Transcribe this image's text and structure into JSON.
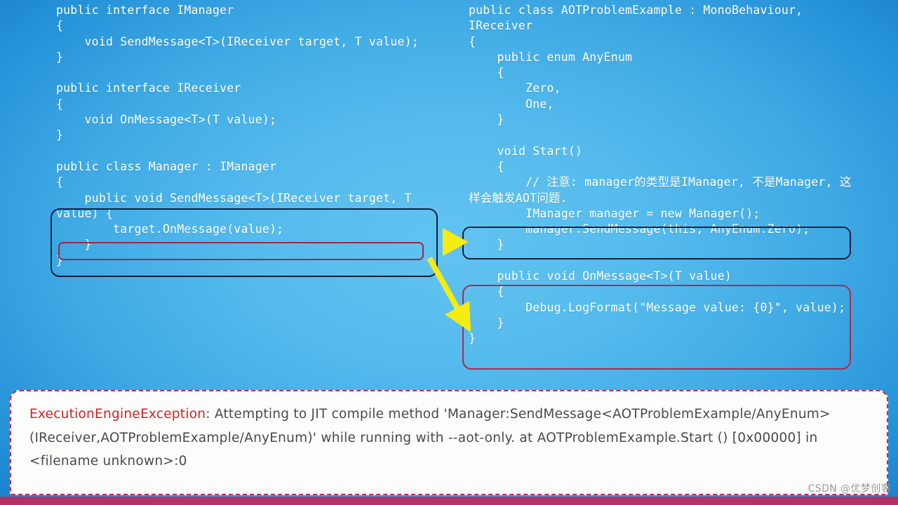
{
  "slide": {
    "background_color_center": "#5bbdee",
    "background_color_edge": "#0f6fc0"
  },
  "code_left": {
    "lines": [
      "public interface IManager",
      "{",
      "    void SendMessage<T>(IReceiver target, T value);",
      "}",
      "",
      "public interface IReceiver",
      "{",
      "    void OnMessage<T>(T value);",
      "}",
      "",
      "public class Manager : IManager",
      "{",
      "    public void SendMessage<T>(IReceiver target, T value) {",
      "        target.OnMessage(value);",
      "    }",
      "}"
    ]
  },
  "code_right": {
    "lines": [
      "public class AOTProblemExample : MonoBehaviour, IReceiver",
      "{",
      "    public enum AnyEnum",
      "    {",
      "        Zero,",
      "        One,",
      "    }",
      "",
      "    void Start()",
      "    {",
      "        // 注意: manager的类型是IManager, 不是Manager, 这样会触发AOT问题.",
      "        IManager manager = new Manager();",
      "        manager.SendMessage(this, AnyEnum.Zero);",
      "    }",
      "",
      "    public void OnMessage<T>(T value)",
      "    {",
      "        Debug.LogFormat(\"Message value: {0}\", value);",
      "    }",
      "}"
    ]
  },
  "annotations": {
    "box_sendmessage_impl_color": "#14203c",
    "box_target_onmessage_color": "#9e2a46",
    "box_manager_send_color": "#14203c",
    "box_onmessage_impl_color": "#b02a4a",
    "arrow_color": "#f5ec13"
  },
  "error_console": {
    "exception_name": "ExecutionEngineException",
    "message": ": Attempting to JIT compile method 'Manager:SendMessage<AOTProblemExample/AnyEnum>(IReceiver,AOTProblemExample/AnyEnum)' while running with --aot-only. at AOTProblemExample.Start () [0x00000] in <filename unknown>:0",
    "exception_color": "#d22222",
    "panel_border_color": "#c2295c"
  },
  "watermark": {
    "text": "CSDN @优梦创客"
  }
}
